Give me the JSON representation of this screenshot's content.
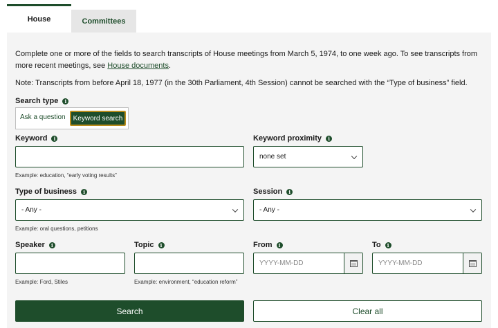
{
  "tabs": [
    {
      "label": "House"
    },
    {
      "label": "Committees"
    }
  ],
  "intro": {
    "text_before": "Complete one or more of the fields to search transcripts of House meetings from March 5, 1974, to one week ago. To see transcripts from more recent meetings, see ",
    "link": "House documents",
    "text_after": "."
  },
  "note": "Note: Transcripts from before April 18, 1977 (in the 30th Parliament, 4th Session) cannot be searched with the “Type of business” field.",
  "search_type": {
    "label": "Search type",
    "option_ask": "Ask a question",
    "option_keyword": "Keyword search",
    "selected": "Keyword search"
  },
  "keyword": {
    "label": "Keyword",
    "value": "",
    "hint": "Example: education, “early voting results”"
  },
  "keyword_proximity": {
    "label": "Keyword proximity",
    "selected": "none set"
  },
  "type_of_business": {
    "label": "Type of business",
    "selected": "- Any -",
    "hint": "Example: oral questions, petitions"
  },
  "session": {
    "label": "Session",
    "selected": "- Any -"
  },
  "speaker": {
    "label": "Speaker",
    "value": "",
    "hint": "Example: Ford, Stiles"
  },
  "topic": {
    "label": "Topic",
    "value": "",
    "hint": "Example: environment, “education reform”"
  },
  "from": {
    "label": "From",
    "placeholder": "YYYY-MM-DD"
  },
  "to": {
    "label": "To",
    "placeholder": "YYYY-MM-DD"
  },
  "buttons": {
    "search": "Search",
    "clear": "Clear all"
  },
  "colors": {
    "accent": "#1e4d2b",
    "focus_ring": "#b98b1a",
    "panel_bg": "#f4f4f4"
  }
}
